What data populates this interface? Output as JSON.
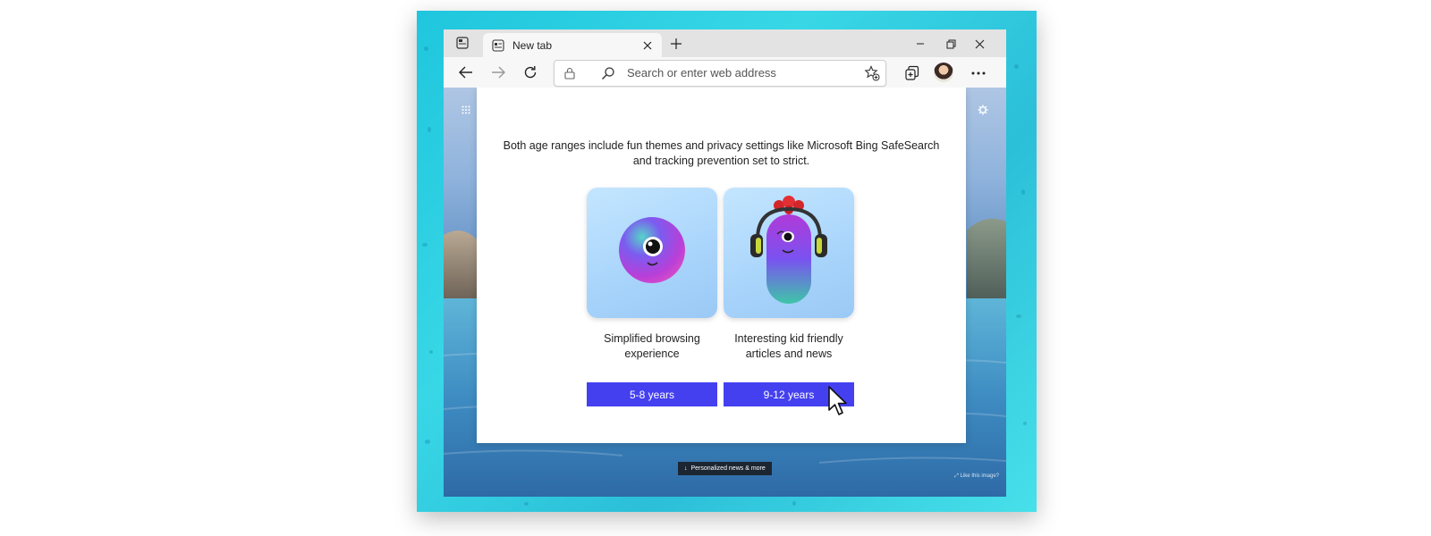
{
  "browser": {
    "tab": {
      "title": "New tab"
    },
    "address": {
      "placeholder": "Search or enter web address"
    }
  },
  "dialog": {
    "description_line1": "Both age ranges include fun themes and privacy settings like Microsoft Bing SafeSearch",
    "description_line2": "and tracking prevention set to strict.",
    "options": [
      {
        "caption_line1": "Simplified browsing",
        "caption_line2": "experience",
        "button": "5-8 years"
      },
      {
        "caption_line1": "Interesting kid friendly",
        "caption_line2": "articles and news",
        "button": "9-12 years"
      }
    ]
  },
  "footer": {
    "news_pill": "Personalized news & more",
    "like_image": "Like this image?"
  },
  "colors": {
    "accent_button": "#4440f0",
    "frame": "#2fcde0"
  },
  "icons": [
    "tab-actions-icon",
    "new-tab-page-icon",
    "close-icon",
    "plus-icon",
    "minimize-icon",
    "restore-icon",
    "window-close-icon",
    "back-arrow-icon",
    "forward-arrow-icon",
    "refresh-icon",
    "lock-icon",
    "search-icon",
    "favorite-star-icon",
    "collections-icon",
    "avatar",
    "more-icon",
    "apps-grid-icon",
    "gear-icon",
    "mouse-cursor-icon"
  ]
}
